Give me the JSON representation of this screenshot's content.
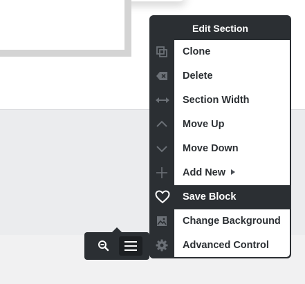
{
  "menu": {
    "title": "Edit Section",
    "items": [
      {
        "label": "Clone",
        "icon": "clone-icon"
      },
      {
        "label": "Delete",
        "icon": "backspace-icon"
      },
      {
        "label": "Section Width",
        "icon": "horizontal-arrows-icon"
      },
      {
        "label": "Move Up",
        "icon": "chevron-up-icon"
      },
      {
        "label": "Move Down",
        "icon": "chevron-down-icon"
      },
      {
        "label": "Add New",
        "icon": "plus-icon",
        "has_submenu": true
      },
      {
        "label": "Save Block",
        "icon": "heart-icon",
        "active": true
      },
      {
        "label": "Change Background",
        "icon": "image-icon"
      },
      {
        "label": "Advanced Control",
        "icon": "gear-icon"
      }
    ]
  },
  "toolbar": {
    "zoom_icon": "zoom-out-icon",
    "menu_icon": "hamburger-icon"
  },
  "colors": {
    "menu_bg": "#2b2f33",
    "menu_text": "#2b2f33",
    "icon_muted": "#6b7076",
    "canvas_band": "#ebecee"
  }
}
